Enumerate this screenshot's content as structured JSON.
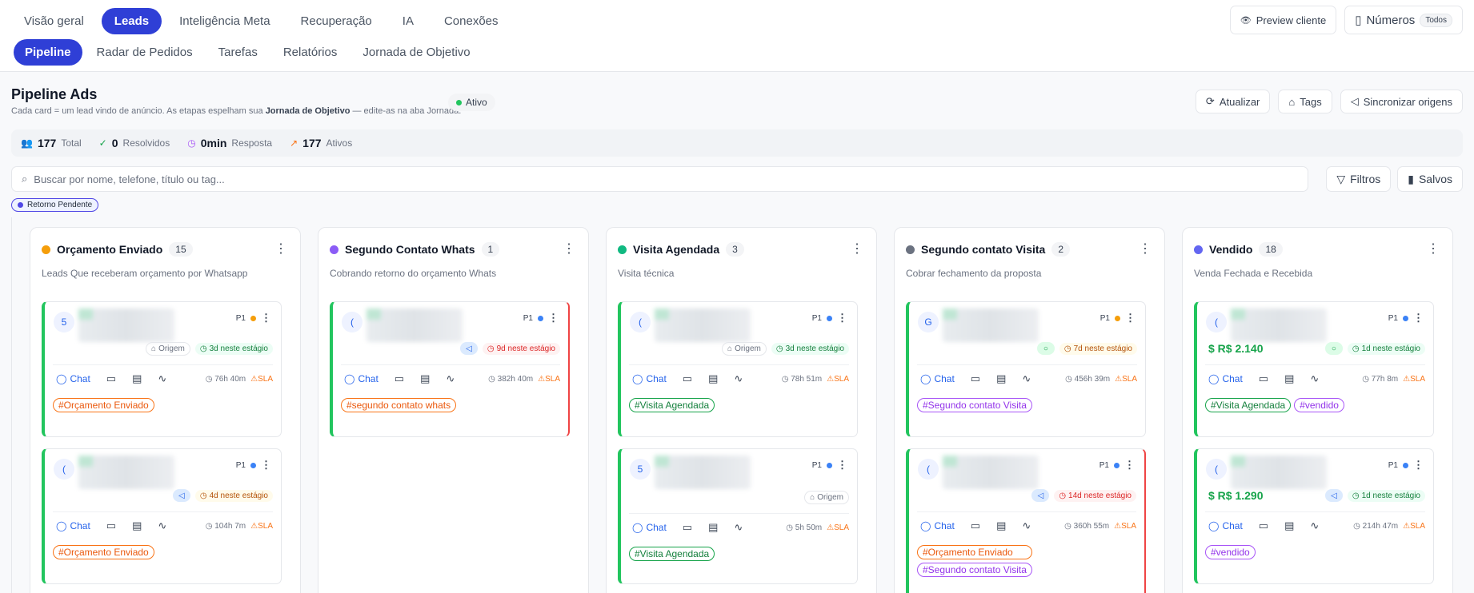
{
  "nav_primary": [
    "Visão geral",
    "Leads",
    "Inteligência Meta",
    "Recuperação",
    "IA",
    "Conexões"
  ],
  "nav_secondary": [
    "Pipeline",
    "Radar de Pedidos",
    "Tarefas",
    "Relatórios",
    "Jornada de Objetivo"
  ],
  "top_right": {
    "preview": "Preview cliente",
    "numbers": "Números",
    "numbers_badge": "Todos"
  },
  "page": {
    "title": "Pipeline Ads",
    "subtitle_a": "Cada card = um lead vindo de anúncio. As etapas espelham sua",
    "subtitle_b": "Jornada de Objetivo",
    "subtitle_c": "— edite-as na aba Jornada.",
    "status": "Ativo",
    "actions": {
      "refresh": "Atualizar",
      "tags": "Tags",
      "sync": "Sincronizar origens"
    }
  },
  "stats": [
    {
      "value": "177",
      "label": "Total"
    },
    {
      "value": "0",
      "label": "Resolvidos"
    },
    {
      "value": "0min",
      "label": "Resposta"
    },
    {
      "value": "177",
      "label": "Ativos"
    }
  ],
  "search": {
    "placeholder": "Buscar por nome, telefone, título ou tag...",
    "filters": "Filtros",
    "saved": "Salvos"
  },
  "active_tag": "Retorno Pendente",
  "card_common": {
    "chat": "Chat",
    "sla": "SLA",
    "priority": "P1",
    "origem": "Origem"
  },
  "columns": [
    {
      "title": "Orçamento Enviado",
      "count": "15",
      "desc": "Leads Que receberam orçamento por Whatsapp",
      "color": "#f59e0b",
      "cards": [
        {
          "avatar": "5",
          "stage": "3d neste estágio",
          "time": "76h 40m",
          "tags": [
            "#Orçamento Enviado"
          ]
        },
        {
          "avatar": "(",
          "stage": "4d neste estágio",
          "time": "104h 7m",
          "tags": [
            "#Orçamento Enviado"
          ]
        }
      ]
    },
    {
      "title": "Segundo Contato Whats",
      "count": "1",
      "desc": "Cobrando retorno do orçamento Whats",
      "color": "#8b5cf6",
      "cards": [
        {
          "avatar": "(",
          "stage": "9d neste estágio",
          "time": "382h 40m",
          "tags": [
            "#segundo contato whats"
          ]
        }
      ]
    },
    {
      "title": "Visita Agendada",
      "count": "3",
      "desc": "Visita técnica",
      "color": "#10b981",
      "cards": [
        {
          "avatar": "(",
          "stage": "3d neste estágio",
          "time": "78h 51m",
          "tags": [
            "#Visita Agendada"
          ]
        },
        {
          "avatar": "5",
          "stage": "",
          "time": "5h 50m",
          "tags": [
            "#Visita Agendada"
          ]
        }
      ]
    },
    {
      "title": "Segundo contato Visita",
      "count": "2",
      "desc": "Cobrar fechamento da proposta",
      "color": "#6b7280",
      "cards": [
        {
          "avatar": "G",
          "stage": "7d neste estágio",
          "time": "456h 39m",
          "tags": [
            "#Segundo contato Visita"
          ]
        },
        {
          "avatar": "(",
          "stage": "14d neste estágio",
          "time": "360h 55m",
          "tags": [
            "#Orçamento Enviado",
            "#Segundo contato Visita"
          ]
        }
      ]
    },
    {
      "title": "Vendido",
      "count": "18",
      "desc": "Venda Fechada e Recebida",
      "color": "#6366f1",
      "cards": [
        {
          "avatar": "(",
          "price": "$ R$ 2.140",
          "stage": "1d neste estágio",
          "time": "77h 8m",
          "tags": [
            "#Visita Agendada",
            "#vendido"
          ]
        },
        {
          "avatar": "(",
          "price": "$ R$ 1.290",
          "stage": "1d neste estágio",
          "time": "214h 47m",
          "tags": [
            "#vendido"
          ]
        }
      ]
    }
  ],
  "colors": {
    "accent": "#2f3fd6",
    "green": "#22c55e",
    "red": "#ef4444"
  }
}
